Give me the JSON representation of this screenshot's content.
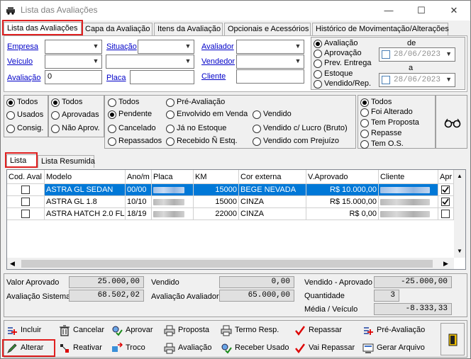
{
  "window": {
    "title": "Lista das Avaliações"
  },
  "tabs": [
    "Lista das Avaliações",
    "Capa da Avaliação",
    "Itens da Avaliação",
    "Opcionais e Acessórios",
    "Histórico de Movimentação/Alterações"
  ],
  "filters": {
    "empresa_label": "Empresa",
    "veiculo_label": "Veículo",
    "avaliacao_label": "Avaliação",
    "avaliacao_value": "0",
    "situacao_label": "Situação",
    "placa_label": "Placa",
    "avaliador_label": "Avaliador",
    "vendedor_label": "Vendedor",
    "cliente_label": "Cliente"
  },
  "date_filter": {
    "options": [
      "Avaliação",
      "Aprovação",
      "Prev. Entrega",
      "Estoque",
      "Vendido/Rep."
    ],
    "de_label": "de",
    "a_label": "a",
    "de_value": "28/06/2023",
    "a_value": "28/06/2023"
  },
  "status_groups": {
    "group1": [
      "Todos",
      "Usados",
      "Consig."
    ],
    "group2": [
      "Todos",
      "Aprovadas",
      "Não Aprov."
    ],
    "group3_col1": [
      "Todos",
      "Pendente",
      "Cancelado",
      "Repassados"
    ],
    "group3_col2": [
      "Pré-Avaliação",
      "Envolvido em Venda",
      "Já no Estoque",
      "Recebido Ñ Estq."
    ],
    "group3_col3": [
      "Vendido",
      "Vendido c/ Lucro (Bruto)",
      "Vendido com Prejuízo"
    ],
    "group4": [
      "Todos",
      "Foi Alterado",
      "Tem Proposta",
      "Repasse",
      "Tem O.S."
    ]
  },
  "list_tabs": [
    "Lista",
    "Lista Resumida"
  ],
  "table": {
    "columns": [
      "Cod. Aval",
      "Modelo",
      "Ano/m",
      "Placa",
      "KM",
      "Cor externa",
      "V.Aprovado",
      "Cliente",
      "Apr"
    ],
    "rows": [
      {
        "modelo": "ASTRA GL SEDAN",
        "ano": "00/00",
        "km": "15000",
        "cor": "BEGE NEVADA",
        "aprovado": "R$ 10.000,00",
        "apr": true
      },
      {
        "modelo": "ASTRA GL 1.8",
        "ano": "10/10",
        "km": "15000",
        "cor": "CINZA",
        "aprovado": "R$ 15.000,00",
        "apr": true
      },
      {
        "modelo": "ASTRA HATCH  2.0 FL",
        "ano": "18/19",
        "km": "22000",
        "cor": "CINZA",
        "aprovado": "R$ 0,00",
        "apr": false
      }
    ]
  },
  "totals": {
    "valor_aprovado_label": "Valor Aprovado",
    "valor_aprovado": "25.000,00",
    "avaliacao_sistema_label": "Avaliação Sistema",
    "avaliacao_sistema": "68.502,02",
    "vendido_label": "Vendido",
    "vendido": "0,00",
    "avaliacao_avaliador_label": "Avaliação Avaliador",
    "avaliacao_avaliador": "65.000,00",
    "vendido_aprovado_label": "Vendido - Aprovado",
    "vendido_aprovado": "-25.000,00",
    "quantidade_label": "Quantidade",
    "quantidade": "3",
    "media_label": "Média / Veículo",
    "media": "-8.333,33"
  },
  "actions": {
    "incluir": "Incluir",
    "alterar": "Alterar",
    "cancelar": "Cancelar",
    "reativar": "Reativar",
    "aprovar": "Aprovar",
    "troco": "Troco",
    "proposta": "Proposta",
    "avaliacao": "Avaliação",
    "termo_resp": "Termo Resp.",
    "receber_usado": "Receber Usado",
    "repassar": "Repassar",
    "vai_repassar": "Vai Repassar",
    "pre_avaliacao": "Pré-Avaliação",
    "gerar_arquivo": "Gerar Arquivo"
  }
}
